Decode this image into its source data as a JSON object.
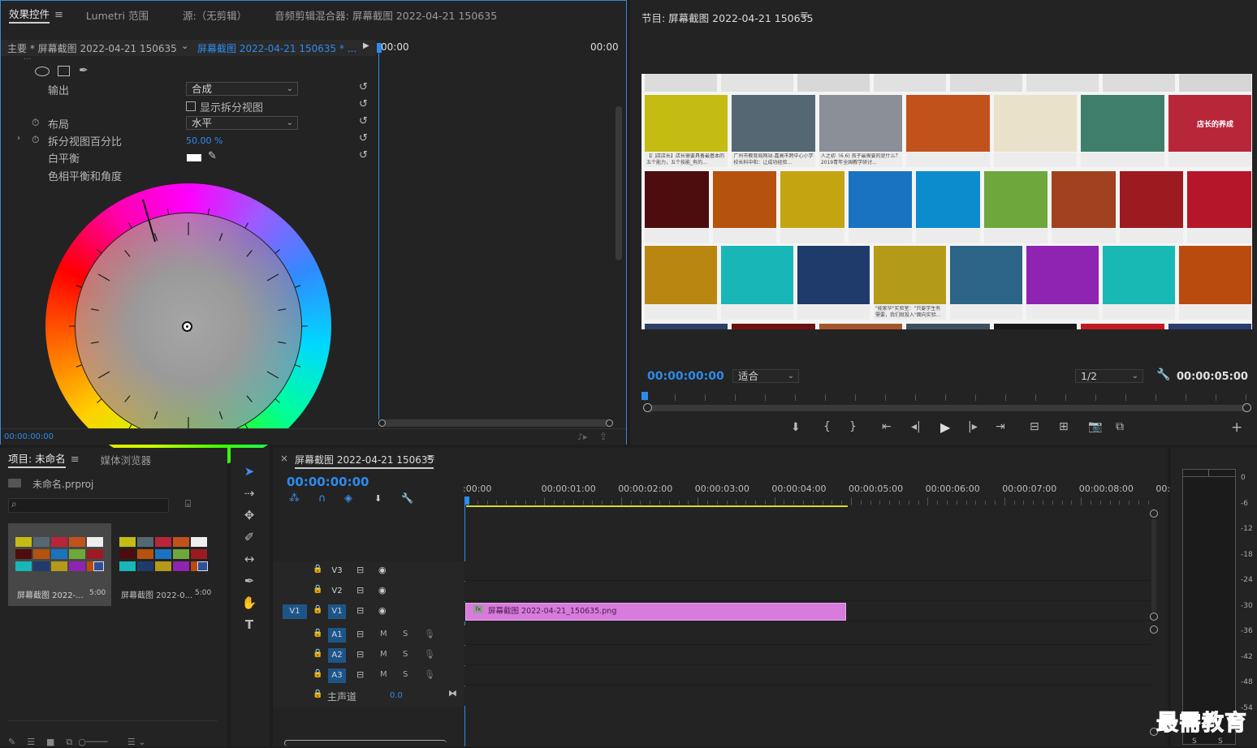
{
  "effect_panel": {
    "tabs": [
      "效果控件",
      "Lumetri 范围",
      "源:（无剪辑）",
      "音频剪辑混合器: 屏幕截图 2022-04-21 150635"
    ],
    "menu_icon": "≡",
    "master_clip": "主要 * 屏幕截图 2022-04-21 150635...",
    "sequence_clip": "屏幕截图 2022-04-21 150635 * ...",
    "truncated_header": "...",
    "ruler_start": "00:00",
    "ruler_end": "00:00",
    "output_label": "输出",
    "output_value": "合成",
    "split_view_label": "显示拆分视图",
    "layout_label": "布局",
    "layout_value": "水平",
    "split_pct_label": "拆分视图百分比",
    "split_pct_value": "50.00 %",
    "white_balance_label": "白平衡",
    "hue_label": "色相平衡和角度",
    "timecode": "00:00:00:00"
  },
  "program": {
    "title": "节目: 屏幕截图 2022-04-21 150635",
    "menu_icon": "≡",
    "timecode": "00:00:00:00",
    "fit_value": "适合",
    "res_value": "1/2",
    "duration": "00:00:05:00",
    "add_icon": "+",
    "preview_captions": [
      "【门店店长】店长需要具备最基本的五个能力，五个技能_有的...",
      "广州市教育局网站-嘉高市跨中心小学校长科中和：让成功经验...",
      "人之初（6.6) 孩子最需要的是什么？2019青年全国教学研讨...",
      "\"能家华\"实验室：\"只要学生有需要，我们就投入\"面向实验...",
      "店长的养成"
    ]
  },
  "project": {
    "tabs": [
      "项目: 未命名",
      "媒体浏览器"
    ],
    "menu_icon": "≡",
    "file": "未命名.prproj",
    "items": [
      {
        "name": "屏幕截图 2022-...",
        "dur": "5:00"
      },
      {
        "name": "屏幕截图 2022-0...",
        "dur": "5:00"
      }
    ]
  },
  "timeline": {
    "close": "×",
    "title": "屏幕截图 2022-04-21 150635",
    "menu_icon": "≡",
    "timecode": "00:00:00:00",
    "ticks": [
      ":00:00",
      "00:00:01:00",
      "00:00:02:00",
      "00:00:03:00",
      "00:00:04:00",
      "00:00:05:00",
      "00:00:06:00",
      "00:00:07:00",
      "00:00:08:00",
      "00:0"
    ],
    "video_tracks": [
      "V3",
      "V2",
      "V1"
    ],
    "audio_tracks": [
      "A1",
      "A2",
      "A3"
    ],
    "source_patch": "V1",
    "mute": "M",
    "solo": "S",
    "master_label": "主声道",
    "master_value": "0.0",
    "clip_label": "屏幕截图 2022-04-21_150635.png",
    "fx_badge": "fx"
  },
  "meter": {
    "labels": [
      "0",
      "-6",
      "-12",
      "-18",
      "-24",
      "-30",
      "-36",
      "-42",
      "-48",
      "-54"
    ],
    "bottom": [
      "S",
      "S"
    ]
  },
  "watermark": "最需教育",
  "colors": {
    "accent": "#2d8ceb",
    "clip": "#d77bdc",
    "bg": "#232323",
    "workbar": "#d8d82a"
  }
}
